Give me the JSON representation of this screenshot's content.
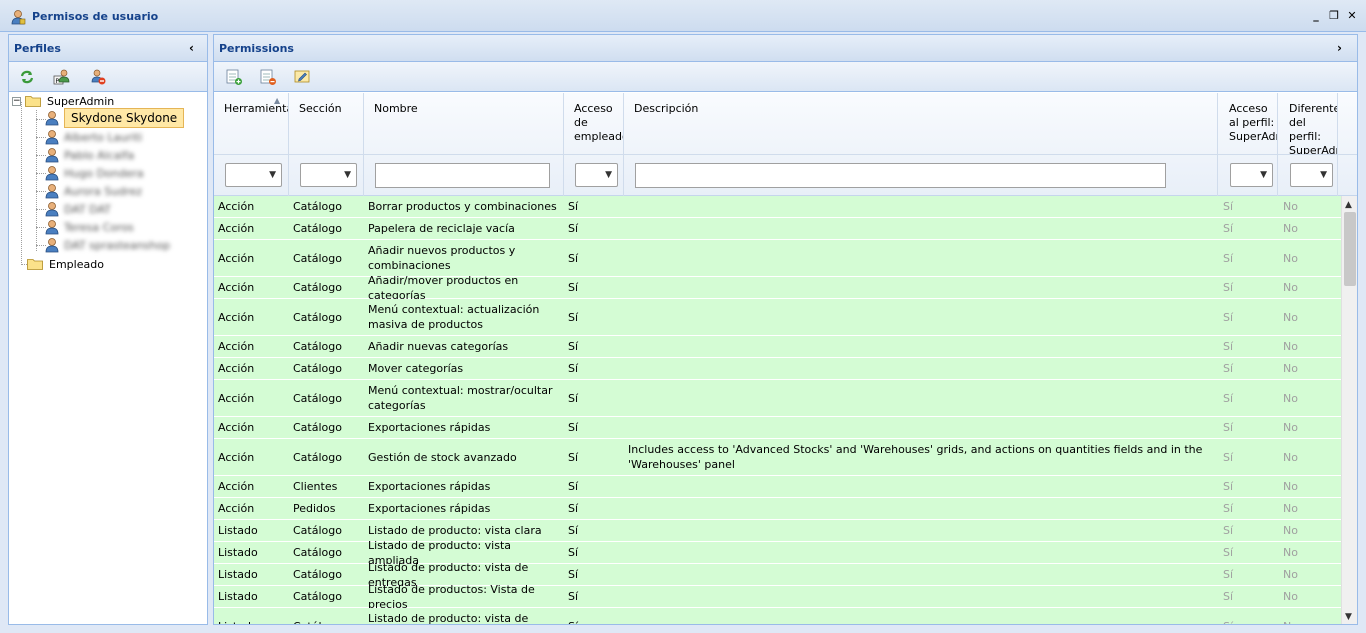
{
  "window": {
    "title": "Permisos de usuario",
    "controls": {
      "minimize": "_",
      "restore": "❐",
      "close": "✕"
    }
  },
  "profiles_panel": {
    "title": "Perfiles",
    "toolbar_icons": [
      "refresh-icon",
      "user-profile-icon",
      "user-delete-icon"
    ],
    "tree": {
      "root": "SuperAdmin",
      "selected_user": "Skydone Skydone",
      "blurred_users": [
        "Alberto Lauriti",
        "Pablo Alcalfa",
        "Hugo Dondera",
        "Aurora Sudrez",
        "DAT DAT",
        "Teresa Coros",
        "DAT sprasteanshop"
      ],
      "second_group": "Empleado"
    }
  },
  "permissions_panel": {
    "title": "Permissions",
    "toolbar_icons": [
      "grid-add-icon",
      "grid-delete-icon",
      "edit-icon"
    ],
    "columns": {
      "herramienta": "Herramienta",
      "seccion": "Sección",
      "nombre": "Nombre",
      "acceso": "Acceso de empleado",
      "descripcion": "Descripción",
      "acceso_perfil": "Acceso al perfil: SuperAdm",
      "diferente": "Diferente del perfil: SuperAdm"
    },
    "filter_arrow": "▼",
    "rows": [
      {
        "herramienta": "Acción",
        "seccion": "Catálogo",
        "nombre": "Borrar productos y combinaciones",
        "acceso": "Sí",
        "descripcion": "",
        "acceso_perfil": "Sí",
        "diferente": "No"
      },
      {
        "herramienta": "Acción",
        "seccion": "Catálogo",
        "nombre": "Papelera de reciclaje vacía",
        "acceso": "Sí",
        "descripcion": "",
        "acceso_perfil": "Sí",
        "diferente": "No"
      },
      {
        "herramienta": "Acción",
        "seccion": "Catálogo",
        "nombre": "Añadir nuevos productos y combinaciones",
        "acceso": "Sí",
        "descripcion": "",
        "acceso_perfil": "Sí",
        "diferente": "No"
      },
      {
        "herramienta": "Acción",
        "seccion": "Catálogo",
        "nombre": "Añadir/mover productos en categorías",
        "acceso": "Sí",
        "descripcion": "",
        "acceso_perfil": "Sí",
        "diferente": "No"
      },
      {
        "herramienta": "Acción",
        "seccion": "Catálogo",
        "nombre": "Menú contextual: actualización masiva de productos",
        "acceso": "Sí",
        "descripcion": "",
        "acceso_perfil": "Sí",
        "diferente": "No"
      },
      {
        "herramienta": "Acción",
        "seccion": "Catálogo",
        "nombre": "Añadir nuevas categorías",
        "acceso": "Sí",
        "descripcion": "",
        "acceso_perfil": "Sí",
        "diferente": "No"
      },
      {
        "herramienta": "Acción",
        "seccion": "Catálogo",
        "nombre": "Mover categorías",
        "acceso": "Sí",
        "descripcion": "",
        "acceso_perfil": "Sí",
        "diferente": "No"
      },
      {
        "herramienta": "Acción",
        "seccion": "Catálogo",
        "nombre": "Menú contextual: mostrar/ocultar categorías",
        "acceso": "Sí",
        "descripcion": "",
        "acceso_perfil": "Sí",
        "diferente": "No"
      },
      {
        "herramienta": "Acción",
        "seccion": "Catálogo",
        "nombre": "Exportaciones rápidas",
        "acceso": "Sí",
        "descripcion": "",
        "acceso_perfil": "Sí",
        "diferente": "No"
      },
      {
        "herramienta": "Acción",
        "seccion": "Catálogo",
        "nombre": "Gestión de stock avanzado",
        "acceso": "Sí",
        "descripcion": "Includes access to 'Advanced Stocks' and 'Warehouses' grids, and actions on quantities fields and in the 'Warehouses' panel",
        "acceso_perfil": "Sí",
        "diferente": "No"
      },
      {
        "herramienta": "Acción",
        "seccion": "Clientes",
        "nombre": "Exportaciones rápidas",
        "acceso": "Sí",
        "descripcion": "",
        "acceso_perfil": "Sí",
        "diferente": "No"
      },
      {
        "herramienta": "Acción",
        "seccion": "Pedidos",
        "nombre": "Exportaciones rápidas",
        "acceso": "Sí",
        "descripcion": "",
        "acceso_perfil": "Sí",
        "diferente": "No"
      },
      {
        "herramienta": "Listado",
        "seccion": "Catálogo",
        "nombre": "Listado de producto: vista clara",
        "acceso": "Sí",
        "descripcion": "",
        "acceso_perfil": "Sí",
        "diferente": "No"
      },
      {
        "herramienta": "Listado",
        "seccion": "Catálogo",
        "nombre": "Listado de producto: vista ampliada",
        "acceso": "Sí",
        "descripcion": "",
        "acceso_perfil": "Sí",
        "diferente": "No"
      },
      {
        "herramienta": "Listado",
        "seccion": "Catálogo",
        "nombre": "Listado de producto: vista de entregas",
        "acceso": "Sí",
        "descripcion": "",
        "acceso_perfil": "Sí",
        "diferente": "No"
      },
      {
        "herramienta": "Listado",
        "seccion": "Catálogo",
        "nombre": "Listado de productos: Vista de precios",
        "acceso": "Sí",
        "descripcion": "",
        "acceso_perfil": "Sí",
        "diferente": "No"
      },
      {
        "herramienta": "Listado",
        "seccion": "Catálogo",
        "nombre": "Listado de producto: vista de",
        "acceso": "Sí",
        "descripcion": "",
        "acceso_perfil": "Sí",
        "diferente": "No"
      }
    ]
  },
  "colors": {
    "row_bg": "#d4fcd4",
    "header_text": "#15428b",
    "border": "#99bbe8"
  }
}
